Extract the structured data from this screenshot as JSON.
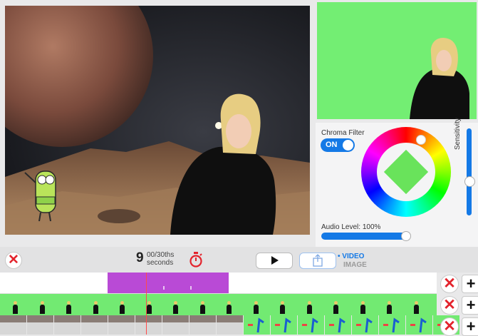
{
  "chroma": {
    "filter_label": "Chroma Filter",
    "toggle_label": "ON",
    "sensitivity_label": "Sensitivity",
    "audio_label": "Audio Level: 100%",
    "audio_level": 1.0,
    "sensitivity_level": 0.4,
    "key_color": "#69e35b"
  },
  "toolbar": {
    "time_value": "9",
    "time_fraction": "00/30ths",
    "time_unit": "seconds",
    "mode_video": "• VIDEO",
    "mode_image": "IMAGE"
  },
  "colors": {
    "accent": "#1479e6",
    "delete": "#e3232c",
    "green_screen": "#73ee73",
    "clip": "#b94ad6"
  },
  "icons": {
    "close": "close-icon",
    "timer": "stopwatch-icon",
    "play": "play-icon",
    "share": "share-icon",
    "add": "plus-icon"
  }
}
